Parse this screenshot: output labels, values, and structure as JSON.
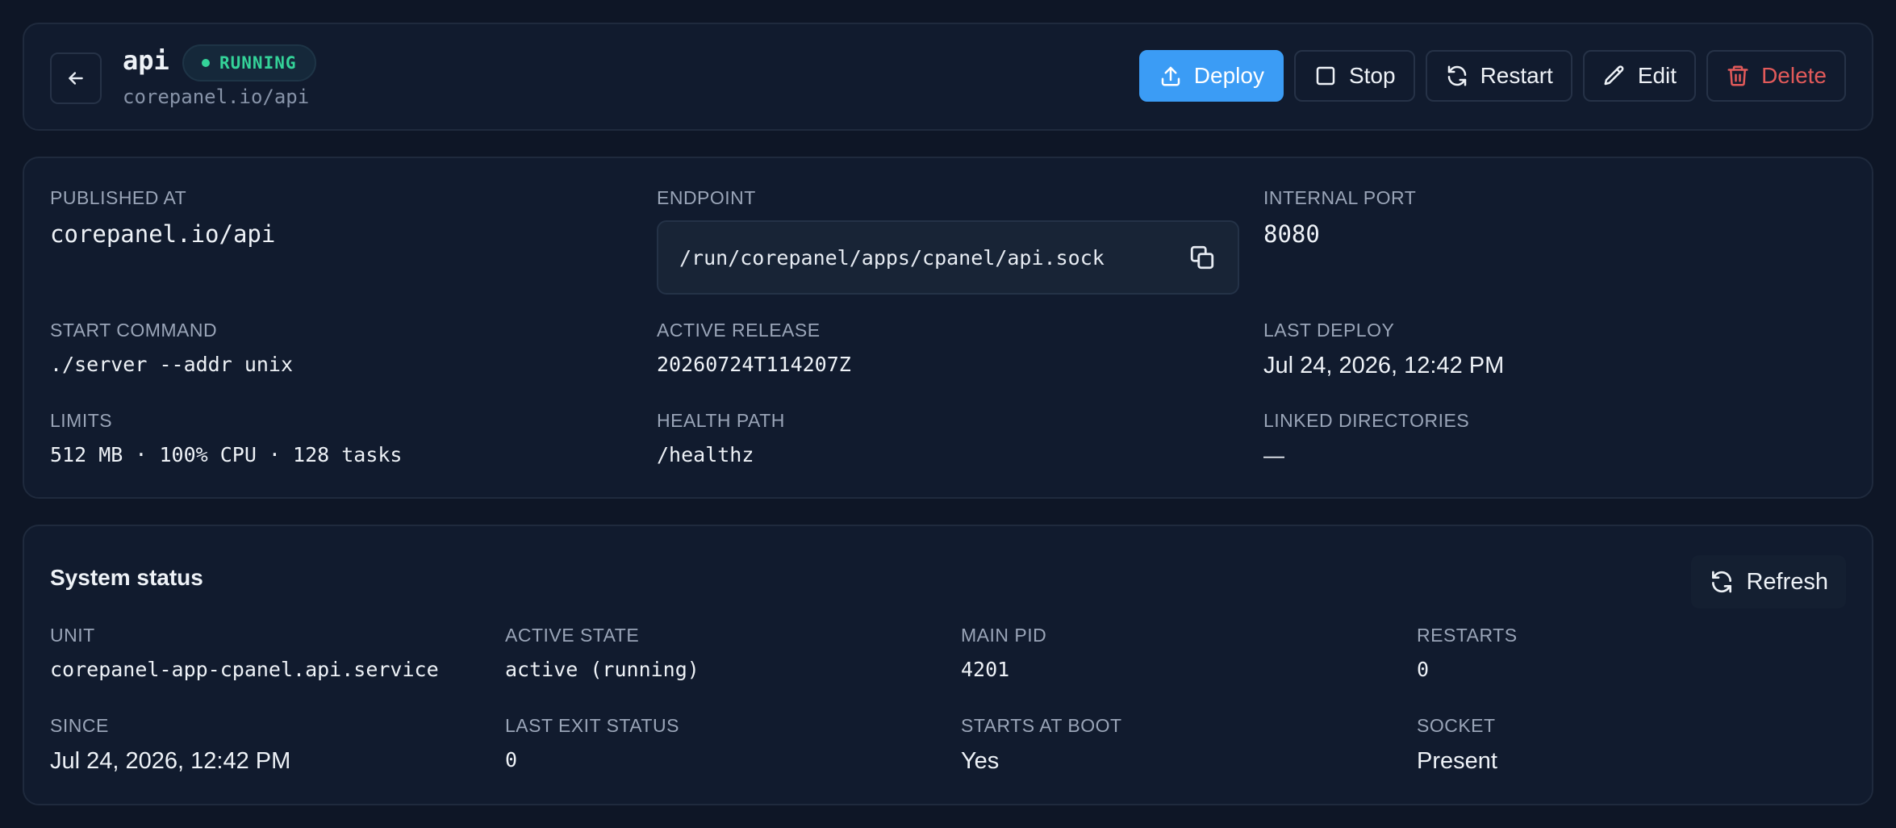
{
  "app": {
    "name": "api",
    "status": "RUNNING",
    "url": "corepanel.io/api"
  },
  "actions": {
    "deploy": "Deploy",
    "stop": "Stop",
    "restart": "Restart",
    "edit": "Edit",
    "delete": "Delete"
  },
  "details": {
    "published_at": {
      "label": "PUBLISHED AT",
      "value": "corepanel.io/api"
    },
    "endpoint": {
      "label": "ENDPOINT",
      "value": "/run/corepanel/apps/cpanel/api.sock"
    },
    "internal_port": {
      "label": "INTERNAL PORT",
      "value": "8080"
    },
    "start_command": {
      "label": "START COMMAND",
      "value": "./server --addr unix"
    },
    "active_release": {
      "label": "ACTIVE RELEASE",
      "value": "20260724T114207Z"
    },
    "last_deploy": {
      "label": "LAST DEPLOY",
      "value": "Jul 24, 2026, 12:42 PM"
    },
    "limits": {
      "label": "LIMITS",
      "value": "512 MB · 100% CPU · 128 tasks"
    },
    "health_path": {
      "label": "HEALTH PATH",
      "value": "/healthz"
    },
    "linked_directories": {
      "label": "LINKED DIRECTORIES",
      "value": "—"
    }
  },
  "system_status": {
    "title": "System status",
    "refresh": "Refresh",
    "unit": {
      "label": "UNIT",
      "value": "corepanel-app-cpanel.api.service"
    },
    "active_state": {
      "label": "ACTIVE STATE",
      "value": "active (running)"
    },
    "main_pid": {
      "label": "MAIN PID",
      "value": "4201"
    },
    "restarts": {
      "label": "RESTARTS",
      "value": "0"
    },
    "since": {
      "label": "SINCE",
      "value": "Jul 24, 2026, 12:42 PM"
    },
    "last_exit_status": {
      "label": "LAST EXIT STATUS",
      "value": "0"
    },
    "starts_at_boot": {
      "label": "STARTS AT BOOT",
      "value": "Yes"
    },
    "socket": {
      "label": "SOCKET",
      "value": "Present"
    }
  },
  "colors": {
    "background": "#0e1626",
    "card": "#111b2e",
    "primary": "#3b9cf5",
    "success": "#34d399",
    "danger": "#e25a5a"
  },
  "icons": {
    "back": "arrow-left-icon",
    "deploy": "upload-icon",
    "stop": "square-icon",
    "restart": "refresh-icon",
    "edit": "pencil-icon",
    "delete": "trash-icon",
    "copy": "copy-icon"
  }
}
